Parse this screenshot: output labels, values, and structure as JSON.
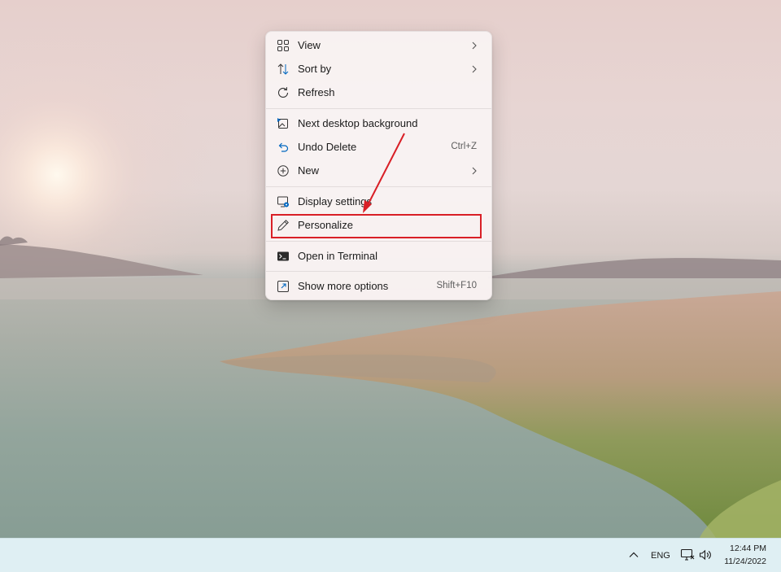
{
  "desktop": {
    "wallpaper": "lake-landscape-at-sunrise"
  },
  "context_menu": {
    "items": [
      {
        "label": "View",
        "icon": "grid-view-icon",
        "has_submenu": true
      },
      {
        "label": "Sort by",
        "icon": "sort-arrows-icon",
        "has_submenu": true
      },
      {
        "label": "Refresh",
        "icon": "refresh-icon"
      },
      {
        "label": "Next desktop background",
        "icon": "next-background-icon"
      },
      {
        "label": "Undo Delete",
        "icon": "undo-icon",
        "shortcut": "Ctrl+Z"
      },
      {
        "label": "New",
        "icon": "add-circle-icon",
        "has_submenu": true
      },
      {
        "label": "Display settings",
        "icon": "display-settings-icon"
      },
      {
        "label": "Personalize",
        "icon": "pen-icon",
        "highlighted": true
      },
      {
        "label": "Open in Terminal",
        "icon": "terminal-icon"
      },
      {
        "label": "Show more options",
        "icon": "show-more-icon",
        "shortcut": "Shift+F10"
      }
    ]
  },
  "annotation": {
    "color": "#d91f26",
    "target": "Personalize"
  },
  "taskbar": {
    "tray": {
      "overflow_icon": "chevron-up-icon",
      "language": "ENG",
      "network_icon": "network-icon",
      "volume_icon": "volume-icon",
      "time": "12:44 PM",
      "date": "11/24/2022"
    }
  },
  "colors": {
    "menu_background": "#f9f3f3",
    "taskbar_background": "#dfeff3",
    "accent_blue": "#0067c0",
    "annotation_red": "#d91f26"
  }
}
